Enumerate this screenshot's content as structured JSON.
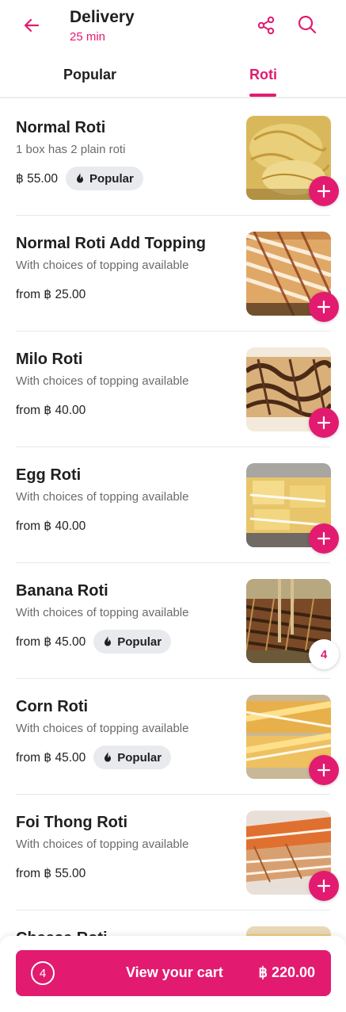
{
  "header": {
    "title": "Delivery",
    "subtitle": "25 min",
    "back_icon": "arrow-left-icon",
    "share_icon": "share-icon",
    "search_icon": "search-icon",
    "accent_color": "#e21b70"
  },
  "tabs": [
    {
      "label": "Popular",
      "active": false
    },
    {
      "label": "Roti",
      "active": true
    }
  ],
  "items": [
    {
      "name": "Normal Roti",
      "desc": "1 box has 2 plain roti",
      "price": "฿ 55.00",
      "badge": "Popular",
      "action": "add",
      "image": "plain-roti-photo"
    },
    {
      "name": "Normal Roti Add Topping",
      "desc": "With choices of topping available",
      "price": "from ฿ 25.00",
      "badge": "",
      "action": "add",
      "image": "roti-topping-photo"
    },
    {
      "name": "Milo Roti",
      "desc": "With choices of topping available",
      "price": "from ฿ 40.00",
      "badge": "",
      "action": "add",
      "image": "milo-roti-photo"
    },
    {
      "name": "Egg Roti",
      "desc": "With choices of topping available",
      "price": "from ฿ 40.00",
      "badge": "",
      "action": "add",
      "image": "egg-roti-photo"
    },
    {
      "name": "Banana Roti",
      "desc": "With choices of topping available",
      "price": "from ฿ 45.00",
      "badge": "Popular",
      "action": "qty",
      "qty": "4",
      "image": "banana-roti-photo"
    },
    {
      "name": "Corn Roti",
      "desc": "With choices of topping available",
      "price": "from ฿ 45.00",
      "badge": "Popular",
      "action": "add",
      "image": "corn-roti-photo"
    },
    {
      "name": "Foi Thong Roti",
      "desc": "With choices of topping available",
      "price": "from ฿ 55.00",
      "badge": "",
      "action": "add",
      "image": "foi-thong-roti-photo"
    },
    {
      "name": "Cheese Roti",
      "desc": "",
      "price": "",
      "badge": "",
      "action": "none",
      "image": "cheese-roti-photo"
    }
  ],
  "cart": {
    "count": "4",
    "label": "View your cart",
    "total": "฿ 220.00"
  }
}
